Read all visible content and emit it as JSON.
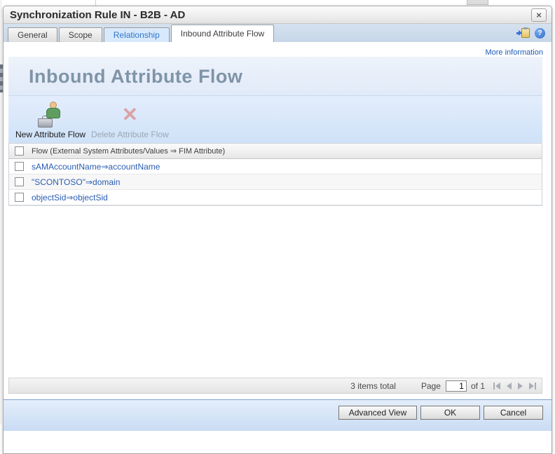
{
  "window": {
    "title": "Synchronization Rule IN - B2B - AD",
    "close_glyph": "×"
  },
  "tabs": {
    "items": [
      {
        "label": "General"
      },
      {
        "label": "Scope"
      },
      {
        "label": "Relationship"
      },
      {
        "label": "Inbound Attribute Flow"
      }
    ],
    "active": "Inbound Attribute Flow"
  },
  "links": {
    "more_information": "More information"
  },
  "page": {
    "heading": "Inbound Attribute Flow"
  },
  "toolbar": {
    "new_label": "New Attribute Flow",
    "delete_label": "Delete Attribute Flow",
    "delete_icon_glyph": "✕"
  },
  "flows": {
    "header": "Flow (External System Attributes/Values ⇒ FIM Attribute)",
    "rows": [
      {
        "label": "sAMAccountName⇒accountName"
      },
      {
        "label": "\"SCONTOSO\"⇒domain"
      },
      {
        "label": "objectSid⇒objectSid"
      }
    ]
  },
  "pagination": {
    "items_total": "3 items total",
    "page_label": "Page",
    "page_value": "1",
    "of_label": "of 1"
  },
  "footer": {
    "advanced_label": "Advanced View",
    "ok_label": "OK",
    "cancel_label": "Cancel"
  },
  "icons": {
    "help_glyph": "?"
  },
  "colors": {
    "link_blue": "#2a5db2",
    "heading_gray_blue": "#7f94a7",
    "tab_strip_blue": "#cbd9ea",
    "footer_blue": "#d6e4f7",
    "delete_red": "#dc9090"
  }
}
